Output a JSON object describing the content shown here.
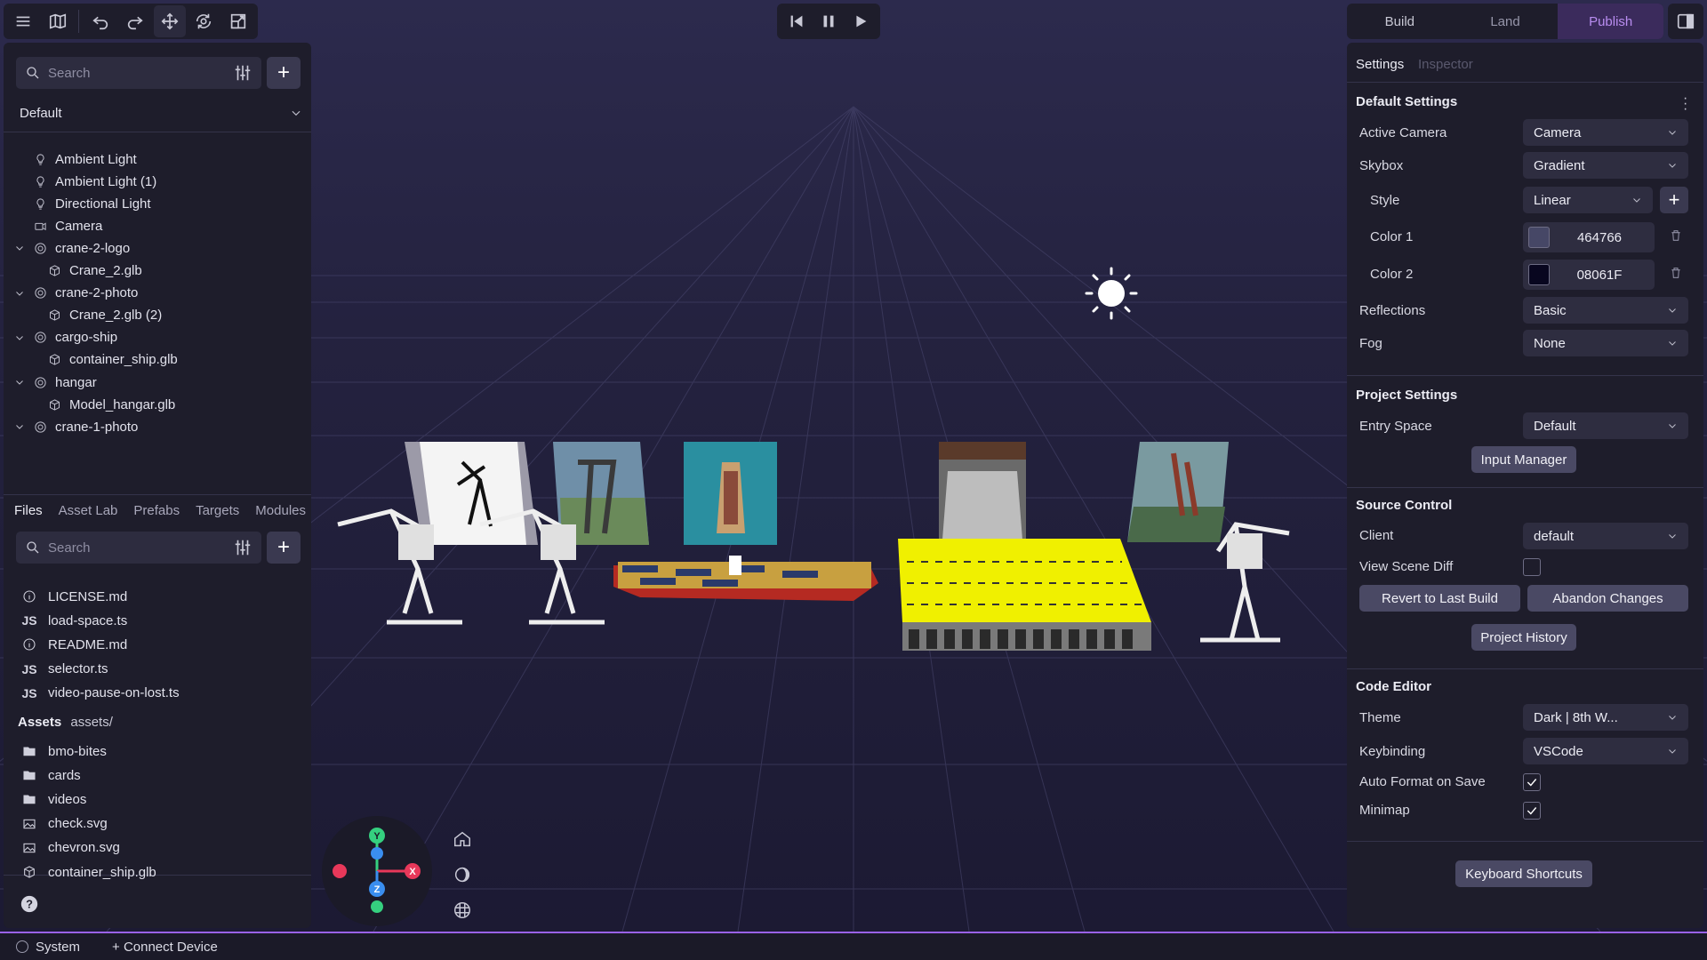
{
  "toolbar": {
    "icons": [
      "menu-icon",
      "map-icon",
      "undo-icon",
      "redo-icon",
      "move-icon",
      "orbit-icon",
      "scale-icon"
    ]
  },
  "playback": {
    "icons": [
      "skip-back-icon",
      "pause-icon",
      "play-icon"
    ]
  },
  "mode_tabs": {
    "build": "Build",
    "land": "Land",
    "publish": "Publish"
  },
  "hierarchy": {
    "search_placeholder": "Search",
    "space": "Default",
    "items": [
      {
        "label": "Ambient Light",
        "icon": "light-icon"
      },
      {
        "label": "Ambient Light (1)",
        "icon": "light-icon"
      },
      {
        "label": "Directional Light",
        "icon": "light-icon"
      },
      {
        "label": "Camera",
        "icon": "camera-icon"
      },
      {
        "label": "crane-2-logo",
        "icon": "object-icon"
      },
      {
        "label": "Crane_2.glb",
        "icon": "cube-icon"
      },
      {
        "label": "crane-2-photo",
        "icon": "object-icon"
      },
      {
        "label": "Crane_2.glb (2)",
        "icon": "cube-icon"
      },
      {
        "label": "cargo-ship",
        "icon": "object-icon"
      },
      {
        "label": "container_ship.glb",
        "icon": "cube-icon"
      },
      {
        "label": "hangar",
        "icon": "object-icon"
      },
      {
        "label": "Model_hangar.glb",
        "icon": "cube-icon"
      },
      {
        "label": "crane-1-photo",
        "icon": "object-icon"
      }
    ]
  },
  "files": {
    "tabs": [
      "Files",
      "Asset Lab",
      "Prefabs",
      "Targets",
      "Modules"
    ],
    "search_placeholder": "Search",
    "items": [
      {
        "label": "LICENSE.md",
        "icon": "info"
      },
      {
        "label": "load-space.ts",
        "icon": "JS"
      },
      {
        "label": "README.md",
        "icon": "info"
      },
      {
        "label": "selector.ts",
        "icon": "JS"
      },
      {
        "label": "video-pause-on-lost.ts",
        "icon": "JS"
      }
    ],
    "assets_label": "Assets",
    "assets_path": "assets/",
    "assets": [
      {
        "label": "bmo-bites",
        "icon": "folder"
      },
      {
        "label": "cards",
        "icon": "folder"
      },
      {
        "label": "videos",
        "icon": "folder"
      },
      {
        "label": "check.svg",
        "icon": "image"
      },
      {
        "label": "chevron.svg",
        "icon": "image"
      },
      {
        "label": "container_ship.glb",
        "icon": "cube"
      }
    ]
  },
  "settings": {
    "tab_settings": "Settings",
    "tab_inspector": "Inspector",
    "default_settings": "Default Settings",
    "active_camera_label": "Active Camera",
    "active_camera": "Camera",
    "skybox_label": "Skybox",
    "skybox": "Gradient",
    "style_label": "Style",
    "style": "Linear",
    "color1_label": "Color 1",
    "color1": "464766",
    "color1_hex": "#464766",
    "color2_label": "Color 2",
    "color2": "08061F",
    "color2_hex": "#08061F",
    "reflections_label": "Reflections",
    "reflections": "Basic",
    "fog_label": "Fog",
    "fog": "None",
    "project_settings": "Project Settings",
    "entry_space_label": "Entry Space",
    "entry_space": "Default",
    "input_manager": "Input Manager",
    "source_control": "Source Control",
    "client_label": "Client",
    "client": "default",
    "view_scene_diff": "View Scene Diff",
    "view_scene_diff_checked": false,
    "revert": "Revert to Last Build",
    "abandon": "Abandon Changes",
    "project_history": "Project History",
    "code_editor": "Code Editor",
    "theme_label": "Theme",
    "theme": "Dark | 8th W...",
    "keybinding_label": "Keybinding",
    "keybinding": "VSCode",
    "auto_format_label": "Auto Format on Save",
    "auto_format_checked": true,
    "minimap_label": "Minimap",
    "minimap_checked": true,
    "keyboard_shortcuts": "Keyboard Shortcuts"
  },
  "gizmo": {
    "x": "X",
    "y": "Y",
    "z": "Z"
  },
  "status": {
    "system": "System",
    "connect": "+ Connect Device"
  },
  "colors": {
    "accent": "#9a62e6",
    "hangar_roof": "#ffff00"
  }
}
